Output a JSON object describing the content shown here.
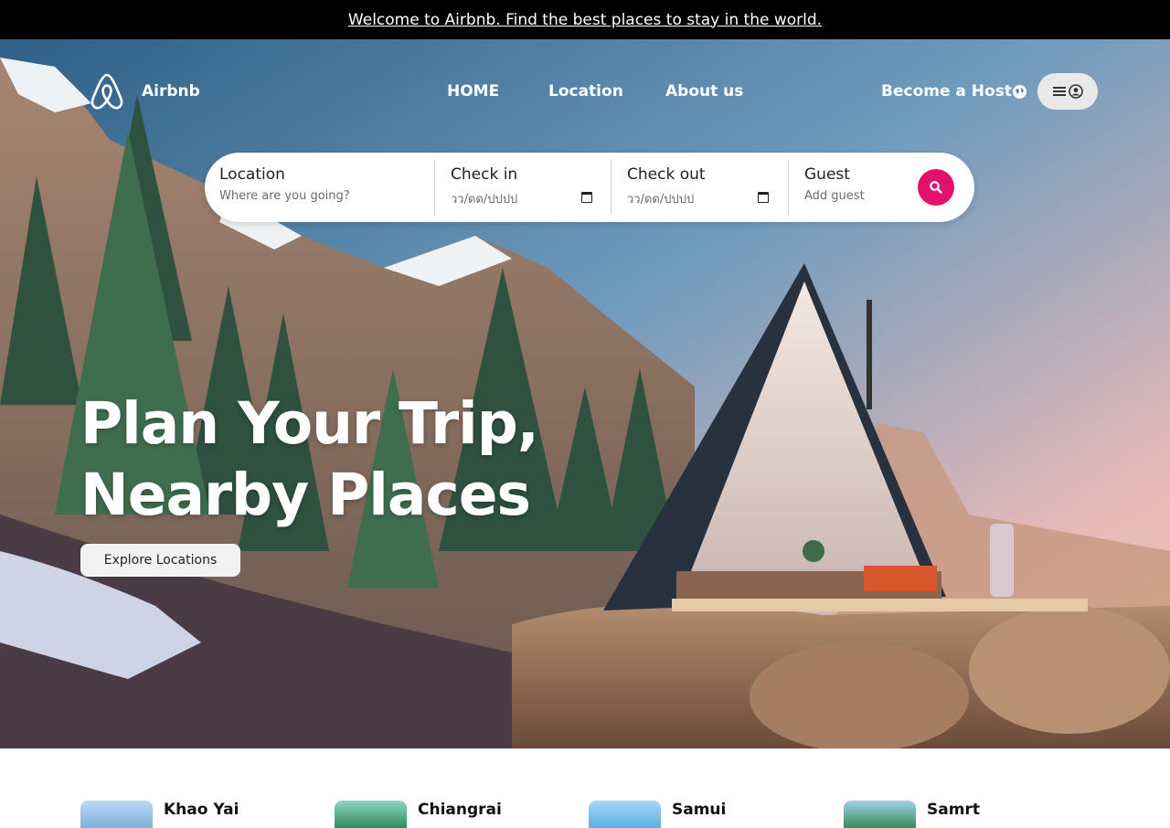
{
  "announcement": "Welcome to Airbnb. Find the best places to stay in the world.",
  "brand": {
    "name": "Airbnb",
    "logo_icon": "airbnb-logo-icon"
  },
  "nav": {
    "links": [
      "HOME",
      "Location",
      "About us"
    ],
    "host_label": "Become a Host",
    "globe_icon": "globe-icon",
    "menu_icon": "hamburger-icon",
    "user_icon": "user-avatar-icon"
  },
  "search": {
    "location": {
      "label": "Location",
      "placeholder": "Where are you going?"
    },
    "check_in": {
      "label": "Check in",
      "placeholder": "วว/ดด/ปปปป"
    },
    "check_out": {
      "label": "Check out",
      "placeholder": "วว/ดด/ปปปป"
    },
    "guest": {
      "label": "Guest",
      "placeholder": "Add guest"
    },
    "button_icon": "search-icon"
  },
  "hero": {
    "headline_line1": "Plan Your Trip,",
    "headline_line2": "Nearby Places",
    "cta": "Explore Locations"
  },
  "places": [
    "Khao Yai",
    "Chiangrai",
    "Samui",
    "Samrt"
  ],
  "colors": {
    "accent": "#e3116c",
    "topbar": "#000000"
  }
}
